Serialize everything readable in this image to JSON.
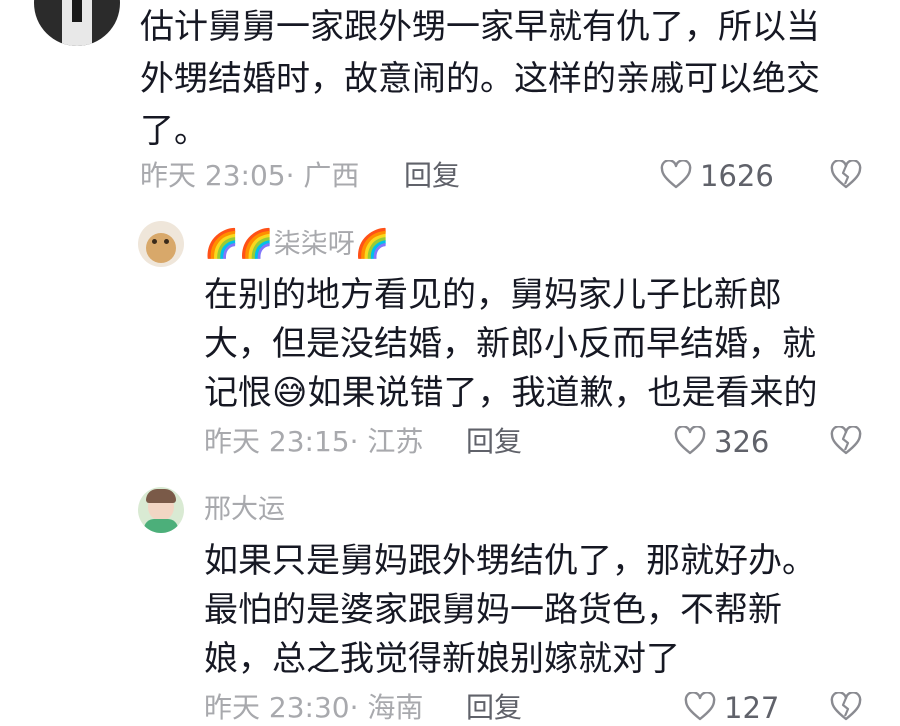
{
  "comments": [
    {
      "text_lines": [
        "估计舅舅一家跟外甥一家早就有仇了，所以当",
        "外甥结婚时，故意闹的。这样的亲戚可以绝交",
        "了。"
      ],
      "time_location": "昨天 23:05· 广西",
      "reply_label": "回复",
      "likes": "1626"
    },
    {
      "username_emoji_prefix": "🌈🌈",
      "username": "柒柒呀",
      "username_emoji_suffix": "🌈",
      "text_lines": [
        "在别的地方看见的，舅妈家儿子比新郎",
        "大，但是没结婚，新郎小反而早结婚，就"
      ],
      "line3_before": "记恨",
      "line3_emoji": "😅",
      "line3_after": "如果说错了，我道歉，也是看来的",
      "time_location": "昨天 23:15· 江苏",
      "reply_label": "回复",
      "likes": "326"
    },
    {
      "username": "邢大运",
      "text_lines": [
        "如果只是舅妈跟外甥结仇了，那就好办。",
        "最怕的是婆家跟舅妈一路货色，不帮新",
        "娘，总之我觉得新娘别嫁就对了"
      ],
      "time_location": "昨天 23:30· 海南",
      "reply_label": "回复",
      "likes": "127"
    }
  ],
  "colors": {
    "text": "#161823",
    "meta": "#a8a9ad",
    "reply": "#60626a"
  },
  "icons": [
    "heart-outline-icon",
    "broken-heart-icon"
  ]
}
